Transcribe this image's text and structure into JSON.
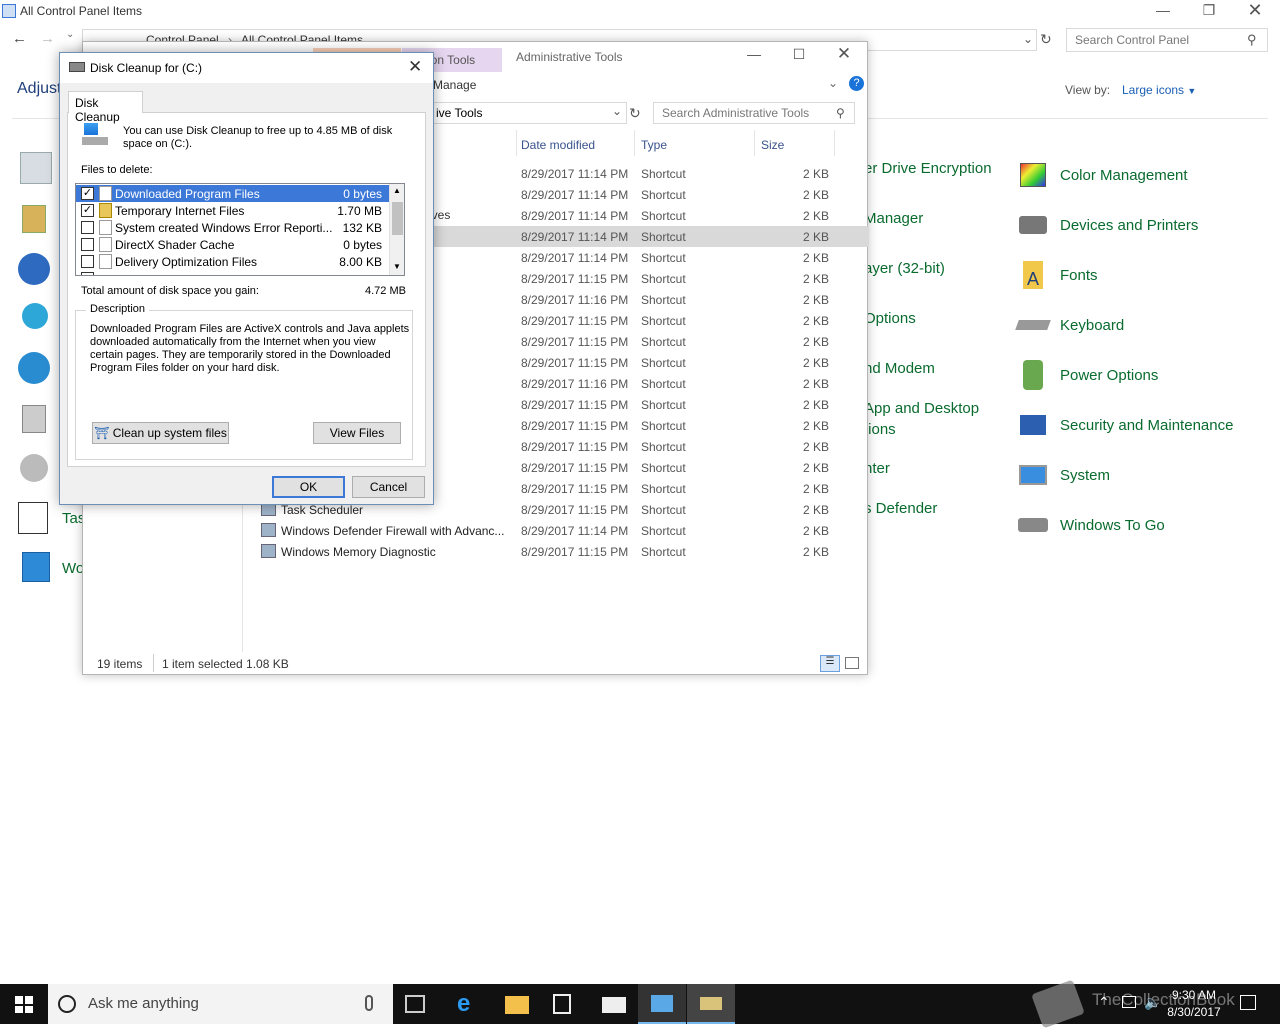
{
  "cp": {
    "title": "All Control Panel Items",
    "breadcrumb": [
      "Control Panel",
      "All Control Panel Items"
    ],
    "search_placeholder": "Search Control Panel",
    "heading_partial": "Adjust",
    "view_by_label": "View by:",
    "view_by_value": "Large icons",
    "col2_items": [
      "er Drive Encryption",
      "Manager",
      "ayer (32-bit)",
      "Options",
      "nd Modem",
      "App and Desktop",
      "tions",
      "nter",
      "s Defender"
    ],
    "col3_items": [
      "Color Management",
      "Devices and Printers",
      "Fonts",
      "Keyboard",
      "Power Options",
      "Security and Maintenance",
      "System",
      "Windows To Go"
    ],
    "col1_partial": [
      "Tas",
      "Wo"
    ]
  },
  "at": {
    "ribbon_tab": "cation Tools",
    "title": "Administrative Tools",
    "manage": "Manage",
    "address": "ive Tools",
    "search_placeholder": "Search Administrative Tools",
    "cols": {
      "date": "Date modified",
      "type": "Type",
      "size": "Size"
    },
    "partial_name_row3": "ives",
    "rows": [
      {
        "date": "8/29/2017 11:14 PM",
        "type": "Shortcut",
        "size": "2 KB"
      },
      {
        "date": "8/29/2017 11:14 PM",
        "type": "Shortcut",
        "size": "2 KB"
      },
      {
        "date": "8/29/2017 11:14 PM",
        "type": "Shortcut",
        "size": "2 KB"
      },
      {
        "date": "8/29/2017 11:14 PM",
        "type": "Shortcut",
        "size": "2 KB"
      },
      {
        "date": "8/29/2017 11:14 PM",
        "type": "Shortcut",
        "size": "2 KB"
      },
      {
        "date": "8/29/2017 11:15 PM",
        "type": "Shortcut",
        "size": "2 KB"
      },
      {
        "date": "8/29/2017 11:16 PM",
        "type": "Shortcut",
        "size": "2 KB"
      },
      {
        "date": "8/29/2017 11:15 PM",
        "type": "Shortcut",
        "size": "2 KB"
      },
      {
        "date": "8/29/2017 11:15 PM",
        "type": "Shortcut",
        "size": "2 KB"
      },
      {
        "date": "8/29/2017 11:15 PM",
        "type": "Shortcut",
        "size": "2 KB"
      },
      {
        "date": "8/29/2017 11:16 PM",
        "type": "Shortcut",
        "size": "2 KB"
      },
      {
        "date": "8/29/2017 11:15 PM",
        "type": "Shortcut",
        "size": "2 KB"
      },
      {
        "date": "8/29/2017 11:15 PM",
        "type": "Shortcut",
        "size": "2 KB"
      },
      {
        "date": "8/29/2017 11:15 PM",
        "type": "Shortcut",
        "size": "2 KB"
      },
      {
        "date": "8/29/2017 11:15 PM",
        "type": "Shortcut",
        "size": "2 KB"
      },
      {
        "date": "8/29/2017 11:15 PM",
        "type": "Shortcut",
        "size": "2 KB"
      },
      {
        "name": "Task Scheduler",
        "date": "8/29/2017 11:15 PM",
        "type": "Shortcut",
        "size": "2 KB"
      },
      {
        "name": "Windows Defender Firewall with Advanc...",
        "date": "8/29/2017 11:14 PM",
        "type": "Shortcut",
        "size": "2 KB"
      },
      {
        "name": "Windows Memory Diagnostic",
        "date": "8/29/2017 11:15 PM",
        "type": "Shortcut",
        "size": "2 KB"
      }
    ],
    "status_count": "19 items",
    "status_sel": "1 item selected  1.08 KB"
  },
  "dc": {
    "title": "Disk Cleanup for  (C:)",
    "tab": "Disk Cleanup",
    "intro": "You can use Disk Cleanup to free up to 4.85 MB of disk space on  (C:).",
    "files_label": "Files to delete:",
    "files": [
      {
        "name": "Downloaded Program Files",
        "size": "0 bytes",
        "checked": true
      },
      {
        "name": "Temporary Internet Files",
        "size": "1.70 MB",
        "checked": true
      },
      {
        "name": "System created Windows Error Reporti...",
        "size": "132 KB",
        "checked": false
      },
      {
        "name": "DirectX Shader Cache",
        "size": "0 bytes",
        "checked": false
      },
      {
        "name": "Delivery Optimization Files",
        "size": "8.00 KB",
        "checked": false
      }
    ],
    "total_label": "Total amount of disk space you gain:",
    "total_value": "4.72 MB",
    "desc_label": "Description",
    "desc_text": "Downloaded Program Files are ActiveX controls and Java applets downloaded automatically from the Internet when you view certain pages. They are temporarily stored in the Downloaded Program Files folder on your hard disk.",
    "clean_btn": "Clean up system files",
    "view_btn": "View Files",
    "ok": "OK",
    "cancel": "Cancel"
  },
  "taskbar": {
    "search": "Ask me anything",
    "time": "9:30 AM",
    "date": "8/30/2017",
    "watermark": "TheCollectionBook"
  }
}
